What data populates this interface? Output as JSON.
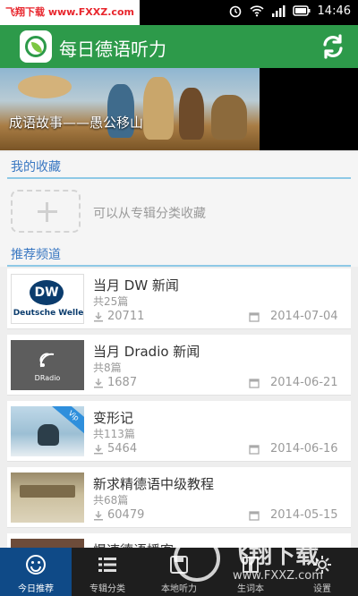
{
  "status_bar": {
    "watermark": "飞翔下载 www.FXXZ.com",
    "time": "14:46",
    "icons": [
      "alarm-icon",
      "wifi-icon",
      "signal-icon",
      "battery-icon"
    ]
  },
  "app_bar": {
    "title": "每日德语听力",
    "icon_left": "app-logo",
    "icon_right": "refresh-icon",
    "color": "#2d9a4a"
  },
  "banner": {
    "caption": "成语故事——愚公移山"
  },
  "favorites": {
    "title": "我的收藏",
    "hint": "可以从专辑分类收藏",
    "add_icon": "plus-icon"
  },
  "recommended": {
    "title": "推荐频道"
  },
  "channels": [
    {
      "title": "当月 DW 新闻",
      "count": "共25篇",
      "downloads": "20711",
      "date": "2014-07-04",
      "thumb_text": "DW",
      "thumb_sub": "Deutsche Welle"
    },
    {
      "title": "当月 Dradio 新闻",
      "count": "共8篇",
      "downloads": "1687",
      "date": "2014-06-21",
      "thumb_sub": "DRadio"
    },
    {
      "title": "变形记",
      "count": "共113篇",
      "downloads": "5464",
      "date": "2014-06-16",
      "badge": "Vip"
    },
    {
      "title": "新求精德语中级教程",
      "count": "共68篇",
      "downloads": "60479",
      "date": "2014-05-15"
    },
    {
      "title": "慢速德语播客"
    }
  ],
  "bottom_nav": [
    {
      "label": "今日推荐",
      "icon": "smiley-icon",
      "active": true
    },
    {
      "label": "专辑分类",
      "icon": "list-icon",
      "active": false
    },
    {
      "label": "本地听力",
      "icon": "disk-icon",
      "active": false
    },
    {
      "label": "生词本",
      "icon": "book-icon",
      "active": false
    },
    {
      "label": "设置",
      "icon": "gear-icon",
      "active": false
    }
  ],
  "watermark_br": {
    "text": "飞翔下载",
    "url": "www.FXXZ.com"
  },
  "colors": {
    "accent_green": "#2d9a4a",
    "section_blue": "#3a78c2",
    "nav_active": "#0f4a87"
  }
}
